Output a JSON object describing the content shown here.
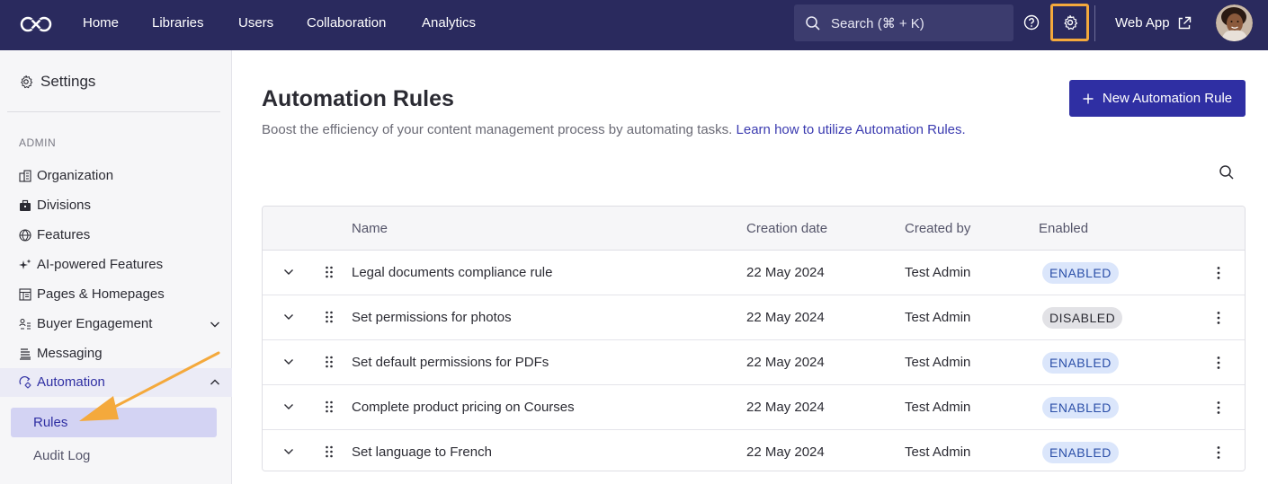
{
  "topbar": {
    "nav": [
      "Home",
      "Libraries",
      "Users",
      "Collaboration",
      "Analytics"
    ],
    "search_label": "Search (⌘ + K)",
    "web_app_label": "Web App",
    "accent_highlight": "#f4a93c",
    "background": "#2a2a5e"
  },
  "sidebar": {
    "title": "Settings",
    "section": "ADMIN",
    "items": [
      {
        "label": "Organization",
        "icon": "building-icon"
      },
      {
        "label": "Divisions",
        "icon": "briefcase-icon"
      },
      {
        "label": "Features",
        "icon": "globe-icon"
      },
      {
        "label": "AI-powered Features",
        "icon": "sparkle-icon"
      },
      {
        "label": "Pages & Homepages",
        "icon": "layout-icon"
      },
      {
        "label": "Buyer Engagement",
        "icon": "engagement-icon"
      },
      {
        "label": "Messaging",
        "icon": "messaging-icon"
      },
      {
        "label": "Automation",
        "icon": "automation-icon"
      }
    ],
    "sub_items": [
      "Rules",
      "Audit Log"
    ]
  },
  "main": {
    "title": "Automation Rules",
    "description": "Boost the efficiency of your content management process by automating tasks.",
    "learn_link": "Learn how to utilize Automation Rules.",
    "new_button": "New Automation Rule",
    "columns": [
      "Name",
      "Creation date",
      "Created by",
      "Enabled"
    ],
    "rows": [
      {
        "name": "Legal documents compliance rule",
        "date": "22 May 2024",
        "by": "Test Admin",
        "status": "ENABLED"
      },
      {
        "name": "Set permissions for photos",
        "date": "22 May 2024",
        "by": "Test Admin",
        "status": "DISABLED"
      },
      {
        "name": "Set default permissions for PDFs",
        "date": "22 May 2024",
        "by": "Test Admin",
        "status": "ENABLED"
      },
      {
        "name": "Complete product pricing on Courses",
        "date": "22 May 2024",
        "by": "Test Admin",
        "status": "ENABLED"
      },
      {
        "name": "Set language to French",
        "date": "22 May 2024",
        "by": "Test Admin",
        "status": "ENABLED"
      }
    ]
  },
  "colors": {
    "primary": "#2f2fa3",
    "enabled_bg": "#dbe6fb",
    "disabled_bg": "#e2e2e6",
    "annotation_arrow": "#f4a93c"
  }
}
